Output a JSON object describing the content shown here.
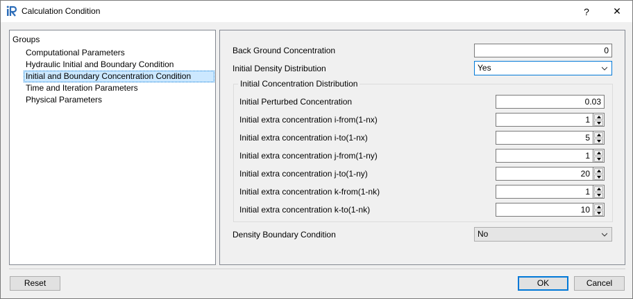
{
  "window": {
    "title": "Calculation Condition",
    "help_label": "?",
    "close_label": "✕"
  },
  "groups": {
    "header": "Groups",
    "items": [
      {
        "label": "Computational Parameters",
        "selected": false
      },
      {
        "label": "Hydraulic Initial and Boundary Condition",
        "selected": false
      },
      {
        "label": "Initial and Boundary Concentration Condition",
        "selected": true
      },
      {
        "label": "Time and Iteration Parameters",
        "selected": false
      },
      {
        "label": "Physical Parameters",
        "selected": false
      }
    ]
  },
  "form": {
    "back_ground_concentration": {
      "label": "Back Ground Concentration",
      "value": "0"
    },
    "initial_density_distribution": {
      "label": "Initial Density Distribution",
      "value": "Yes"
    },
    "initial_concentration_distribution": {
      "title": "Initial Concentration Distribution",
      "perturbed": {
        "label": "Initial Perturbed Concentration",
        "value": "0.03"
      },
      "fields": [
        {
          "label": "Initial extra concentration i-from(1-nx)",
          "value": "1"
        },
        {
          "label": "Initial extra concentration i-to(1-nx)",
          "value": "5"
        },
        {
          "label": "Initial extra concentration j-from(1-ny)",
          "value": "1"
        },
        {
          "label": "Initial extra concentration j-to(1-ny)",
          "value": "20"
        },
        {
          "label": "Initial extra concentration k-from(1-nk)",
          "value": "1"
        },
        {
          "label": "Initial extra concentration k-to(1-nk)",
          "value": "10"
        }
      ]
    },
    "density_boundary_condition": {
      "label": "Density Boundary Condition",
      "value": "No"
    }
  },
  "buttons": {
    "reset": "Reset",
    "ok": "OK",
    "cancel": "Cancel"
  },
  "colors": {
    "accent": "#0078d7",
    "selection_bg": "#cce8ff",
    "logo_blue": "#2b6cb8"
  },
  "icons": {
    "app": "iric-logo-icon",
    "combo_arrow": "chevron-down-icon",
    "spin_up": "spin-up-icon",
    "spin_down": "spin-down-icon"
  }
}
